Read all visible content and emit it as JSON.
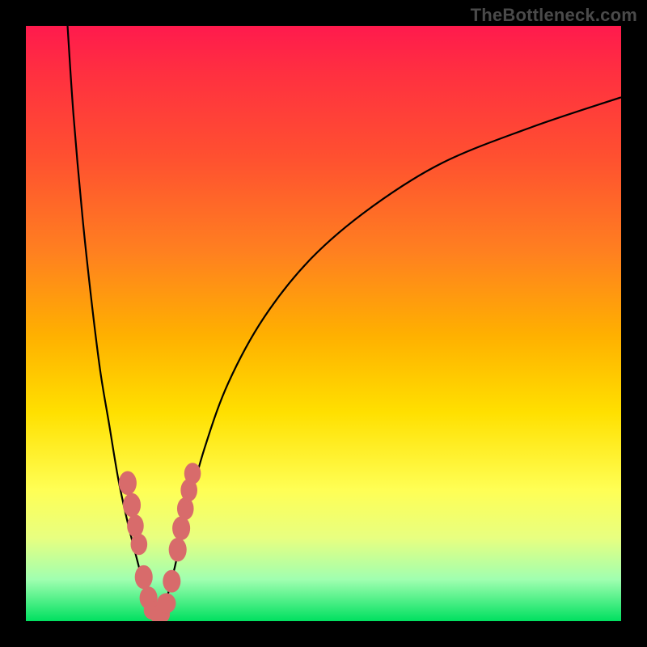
{
  "attribution": "TheBottleneck.com",
  "colors": {
    "bead": "#d86b6b",
    "curve": "#000000",
    "frame": "#000000"
  },
  "chart_data": {
    "type": "line",
    "title": "",
    "xlabel": "",
    "ylabel": "",
    "xlim": [
      0,
      100
    ],
    "ylim": [
      0,
      100
    ],
    "grid": false,
    "legend": false,
    "note": "V-shaped bottleneck curve; values read off plot area (x,y in 0–100 of plot span; y=0 at top, y=100 at bottom).",
    "series": [
      {
        "name": "left-branch",
        "x": [
          7,
          8,
          9.5,
          11,
          12.5,
          14,
          15.5,
          17,
          18.5,
          19.8,
          20.8,
          21.5
        ],
        "y": [
          0,
          15,
          32,
          46,
          58,
          67,
          76,
          83,
          89,
          94,
          97.5,
          99.2
        ]
      },
      {
        "name": "right-branch",
        "x": [
          22.5,
          23.7,
          25,
          27,
          30,
          34,
          40,
          48,
          58,
          70,
          85,
          100
        ],
        "y": [
          99.2,
          96,
          91,
          82,
          71,
          60,
          49,
          39,
          30.5,
          23,
          17,
          12
        ]
      }
    ],
    "beads_note": "Colored marker blobs near the dip, in approximate plot percent coordinates.",
    "beads": [
      {
        "x": 17.1,
        "y": 76.8,
        "rx": 1.5,
        "ry": 2.0
      },
      {
        "x": 17.8,
        "y": 80.5,
        "rx": 1.5,
        "ry": 2.0
      },
      {
        "x": 18.4,
        "y": 84.0,
        "rx": 1.4,
        "ry": 1.9
      },
      {
        "x": 19.0,
        "y": 87.1,
        "rx": 1.4,
        "ry": 1.8
      },
      {
        "x": 19.8,
        "y": 92.6,
        "rx": 1.5,
        "ry": 2.0
      },
      {
        "x": 20.6,
        "y": 96.1,
        "rx": 1.5,
        "ry": 1.9
      },
      {
        "x": 21.4,
        "y": 98.2,
        "rx": 1.6,
        "ry": 1.6
      },
      {
        "x": 22.5,
        "y": 98.9,
        "rx": 1.7,
        "ry": 1.6
      },
      {
        "x": 23.6,
        "y": 97.0,
        "rx": 1.6,
        "ry": 1.7
      },
      {
        "x": 24.5,
        "y": 93.3,
        "rx": 1.5,
        "ry": 1.9
      },
      {
        "x": 25.5,
        "y": 88.0,
        "rx": 1.5,
        "ry": 2.0
      },
      {
        "x": 26.1,
        "y": 84.4,
        "rx": 1.5,
        "ry": 2.0
      },
      {
        "x": 26.8,
        "y": 81.1,
        "rx": 1.4,
        "ry": 1.9
      },
      {
        "x": 27.4,
        "y": 78.0,
        "rx": 1.4,
        "ry": 1.9
      },
      {
        "x": 28.0,
        "y": 75.2,
        "rx": 1.4,
        "ry": 1.8
      }
    ]
  }
}
